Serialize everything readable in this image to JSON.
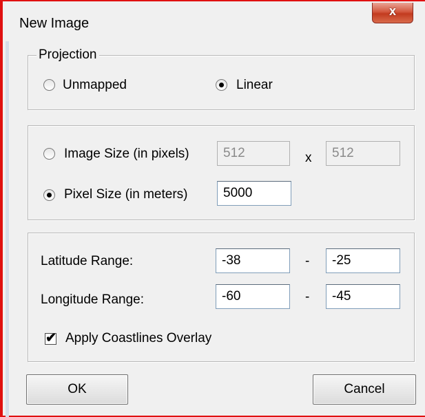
{
  "window": {
    "title": "New Image",
    "close_glyph": "x"
  },
  "projection": {
    "legend": "Projection",
    "options": [
      {
        "label": "Unmapped",
        "selected": false
      },
      {
        "label": "Linear",
        "selected": true
      }
    ]
  },
  "size": {
    "image_size": {
      "label": "Image Size (in pixels)",
      "selected": false,
      "width": "512",
      "separator": "x",
      "height": "512"
    },
    "pixel_size": {
      "label": "Pixel Size (in meters)",
      "selected": true,
      "value": "5000"
    }
  },
  "ranges": {
    "latitude": {
      "label": "Latitude Range:",
      "min": "-38",
      "separator": "-",
      "max": "-25"
    },
    "longitude": {
      "label": "Longitude Range:",
      "min": "-60",
      "separator": "-",
      "max": "-45"
    },
    "coastlines": {
      "label": "Apply Coastlines Overlay",
      "checked": true,
      "check_glyph": "✔"
    }
  },
  "buttons": {
    "ok": "OK",
    "cancel": "Cancel"
  },
  "colors": {
    "window_border": "#e01010",
    "close_button": "#c23a1f",
    "dialog_bg": "#f0f0f0"
  }
}
